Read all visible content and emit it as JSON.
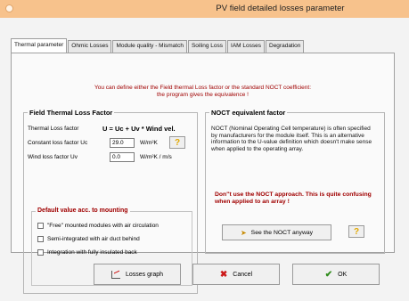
{
  "window": {
    "title": "PV field detailed losses parameter"
  },
  "tabs": [
    {
      "label": "Thermal parameter"
    },
    {
      "label": "Ohmic Losses"
    },
    {
      "label": "Module quality - Mismatch"
    },
    {
      "label": "Soiling Loss"
    },
    {
      "label": "IAM Losses"
    },
    {
      "label": "Degradation"
    }
  ],
  "intro": {
    "line1": "You can define either the Field thermal Loss factor or the standard NOCT coefficient:",
    "line2": "the program gives the equivalence !"
  },
  "thermal": {
    "title": "Field Thermal Loss Factor",
    "label": "Thermal Loss factor",
    "formula": "U = Uc + Uv * Wind vel.",
    "uc_label": "Constant loss factor  Uc",
    "uc_value": "29.0",
    "uc_unit": "W/m²K",
    "uv_label": "Wind loss factor  Uv",
    "uv_value": "0.0",
    "uv_unit": "W/m²K / m/s",
    "help_label": "?"
  },
  "mounting": {
    "title": "Default value acc. to mounting",
    "options": [
      {
        "label": "\"Free\" mounted modules with air circulation",
        "checked": false
      },
      {
        "label": "Semi-integrated with air duct behind",
        "checked": false
      },
      {
        "label": "Integration with fully insulated back",
        "checked": false
      }
    ]
  },
  "noct": {
    "title": "NOCT equivalent factor",
    "description": "NOCT  (Nominal Operating Cell temperature) is often specified by manufacturers  for the module itself. This is an alternative information to the U-value definition which doesn't make sense when applied to the operating array.",
    "warning": "Don''t use the NOCT approach. This is quite confusing when applied to an array !",
    "see_button": "See the NOCT anyway",
    "help_label": "?"
  },
  "buttons": {
    "losses_graph": "Losses graph",
    "cancel": "Cancel",
    "ok": "OK"
  },
  "icons": {
    "graph": "graph-icon",
    "cancel": "cancel-x-icon",
    "ok": "checkmark-icon",
    "arrow": "arrow-right-icon",
    "help": "question-mark-icon"
  },
  "colors": {
    "titlebar": "#f7c28c",
    "accent_red": "#a00000",
    "help_yellow": "#e2a800",
    "ok_green": "#2e8b1a",
    "cancel_red": "#cc1a1a"
  }
}
